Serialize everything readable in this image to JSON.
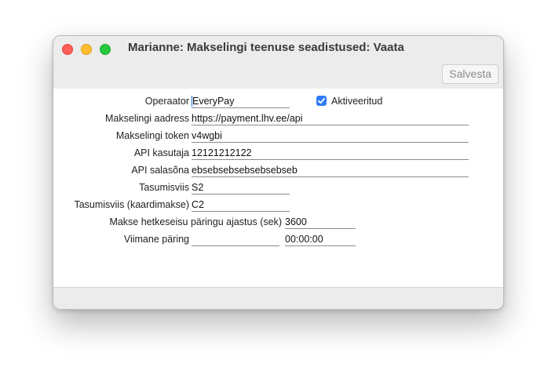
{
  "window": {
    "title": "Marianne: Makselingi teenuse seadistused: Vaata",
    "save_label": "Salvesta"
  },
  "form": {
    "operaator": {
      "label": "Operaator",
      "value": "EveryPay"
    },
    "aktiveeritud": {
      "label": "Aktiveeritud",
      "checked": true
    },
    "makselingi_aadress": {
      "label": "Makselingi aadress",
      "value": "https://payment.lhv.ee/api"
    },
    "makselingi_token": {
      "label": "Makselingi token",
      "value": "v4wgbi"
    },
    "api_kasutaja": {
      "label": "API kasutaja",
      "value": "12121212122"
    },
    "api_salasona": {
      "label": "API salasõna",
      "value": "ebsebsebsebsebsebseb"
    },
    "tasumisviis": {
      "label": "Tasumisviis",
      "value": "S2"
    },
    "tasumisviis_kaart": {
      "label": "Tasumisviis (kaardimakse)",
      "value": "C2"
    },
    "ajastus": {
      "label": "Makse hetkeseisu päringu ajastus (sek)",
      "value": "3600"
    },
    "viimane_paring": {
      "label": "Viimane päring",
      "date": "",
      "time": "00:00:00"
    }
  },
  "colors": {
    "accent": "#2f7bf5",
    "close": "#ff5f57",
    "minimize": "#febc2e",
    "maximize": "#28c840"
  }
}
